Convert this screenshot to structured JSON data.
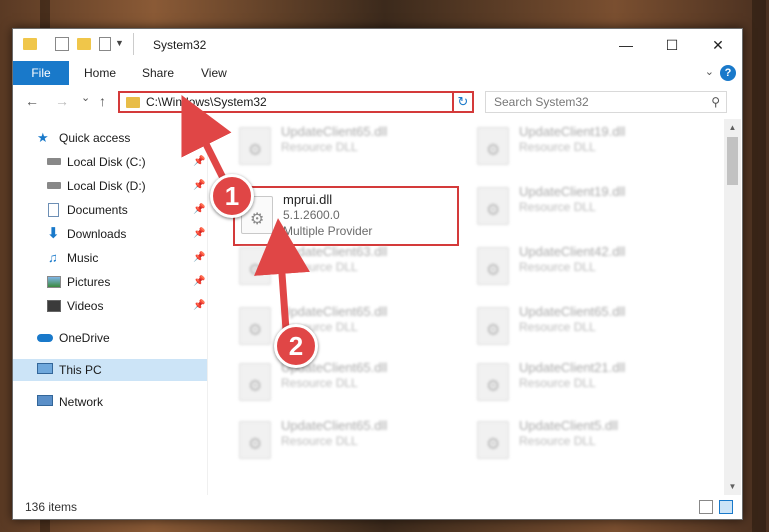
{
  "window": {
    "title": "System32",
    "controls": {
      "minimize": "—",
      "maximize": "☐",
      "close": "✕"
    }
  },
  "ribbon": {
    "file_label": "File",
    "tabs": [
      "Home",
      "Share",
      "View"
    ],
    "help_label": "?"
  },
  "nav": {
    "back": "←",
    "forward": "→",
    "recent": "⌄",
    "up": "↑",
    "address": "C:\\Windows\\System32",
    "refresh_label": "↻",
    "search_placeholder": "Search System32"
  },
  "sidebar": {
    "items": [
      {
        "label": "Quick access",
        "icon": "star-icon",
        "pinned": false
      },
      {
        "label": "Local Disk (C:)",
        "icon": "drive-icon",
        "pinned": true
      },
      {
        "label": "Local Disk (D:)",
        "icon": "drive-icon",
        "pinned": true
      },
      {
        "label": "Documents",
        "icon": "documents-icon",
        "pinned": true
      },
      {
        "label": "Downloads",
        "icon": "download-icon",
        "pinned": true
      },
      {
        "label": "Music",
        "icon": "music-icon",
        "pinned": true
      },
      {
        "label": "Pictures",
        "icon": "pictures-icon",
        "pinned": true
      },
      {
        "label": "Videos",
        "icon": "videos-icon",
        "pinned": true
      },
      {
        "label": "OneDrive",
        "icon": "cloud-icon",
        "pinned": false
      },
      {
        "label": "This PC",
        "icon": "computer-icon",
        "pinned": false,
        "selected": true
      },
      {
        "label": "Network",
        "icon": "network-icon",
        "pinned": false
      }
    ],
    "pin_glyph": "📌"
  },
  "files": {
    "left": [
      {
        "name": "UpdateClient65.dll",
        "type": "Resource DLL"
      },
      {
        "name": "mprui.dll",
        "version": "5.1.2600.0",
        "type": "Multiple Provider",
        "highlighted": true
      },
      {
        "name": "UpdateClient63.dll",
        "type": "Resource DLL"
      },
      {
        "name": "UpdateClient65.dll",
        "type": "Resource DLL"
      },
      {
        "name": "UpdateClient65.dll",
        "type": "Resource DLL"
      },
      {
        "name": "UpdateClient65.dll",
        "type": "Resource DLL"
      }
    ],
    "right": [
      {
        "name": "UpdateClient19.dll",
        "type": "Resource DLL"
      },
      {
        "name": "UpdateClient19.dll",
        "type": "Resource DLL"
      },
      {
        "name": "UpdateClient42.dll",
        "type": "Resource DLL"
      },
      {
        "name": "UpdateClient65.dll",
        "type": "Resource DLL"
      },
      {
        "name": "UpdateClient21.dll",
        "type": "Resource DLL"
      },
      {
        "name": "UpdateClient5.dll",
        "type": "Resource DLL"
      }
    ]
  },
  "status": {
    "item_count": "136 items"
  },
  "annotations": {
    "step1": "1",
    "step2": "2",
    "color": "#e04646"
  }
}
